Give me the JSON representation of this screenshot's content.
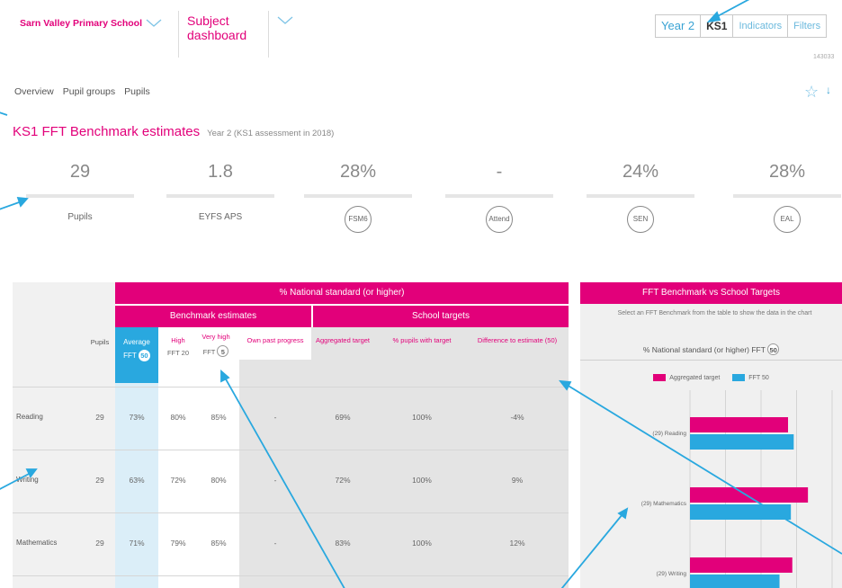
{
  "header": {
    "school_name": "Sarn Valley Primary School",
    "dashboard_title": "Subject dashboard",
    "tabs": [
      "Year 2",
      "KS1",
      "Indicators",
      "Filters"
    ],
    "small_code": "143033"
  },
  "nav": {
    "items": [
      "Overview",
      "Pupil groups",
      "Pupils"
    ]
  },
  "page": {
    "title": "KS1 FFT Benchmark estimates",
    "subtitle": "Year 2 (KS1 assessment in 2018)"
  },
  "stats": [
    {
      "value": "29",
      "label": "Pupils"
    },
    {
      "value": "1.8",
      "label": "EYFS APS"
    },
    {
      "value": "28%",
      "label": "FSM6"
    },
    {
      "value": "-",
      "label": "Attend"
    },
    {
      "value": "24%",
      "label": "SEN"
    },
    {
      "value": "28%",
      "label": "EAL"
    }
  ],
  "table": {
    "top_header": "% National standard (or higher)",
    "group_benchmark": "Benchmark estimates",
    "group_targets": "School targets",
    "columns": {
      "pupils": "Pupils",
      "average": "Average",
      "fft_avg": "FFT",
      "fft_avg_badge": "50",
      "high": "High",
      "fft_high": "FFT 20",
      "very_high": "Very high",
      "fft_vhigh": "FFT",
      "fft_vhigh_badge": "5",
      "own_past": "Own past progress",
      "aggregated": "Aggregated target",
      "pct_pupils": "% pupils with target",
      "difference": "Difference to estimate (50)"
    },
    "rows": [
      {
        "subject": "Reading",
        "pupils": "29",
        "average": "73%",
        "high": "80%",
        "very_high": "85%",
        "own": "-",
        "agg": "69%",
        "pct": "100%",
        "diff": "-4%"
      },
      {
        "subject": "Writing",
        "pupils": "29",
        "average": "63%",
        "high": "72%",
        "very_high": "80%",
        "own": "-",
        "agg": "72%",
        "pct": "100%",
        "diff": "9%"
      },
      {
        "subject": "Mathematics",
        "pupils": "29",
        "average": "71%",
        "high": "79%",
        "very_high": "85%",
        "own": "-",
        "agg": "83%",
        "pct": "100%",
        "diff": "12%"
      }
    ]
  },
  "panel": {
    "title": "FFT Benchmark vs School Targets",
    "note": "Select an FFT Benchmark from the table to show the data in the chart",
    "subtitle": "% National standard (or higher) FFT",
    "subtitle_badge": "50",
    "legend": [
      "Aggregated target",
      "FFT 50"
    ]
  },
  "chart_data": {
    "type": "bar",
    "orientation": "horizontal",
    "categories": [
      "(29) Reading",
      "(29) Mathematics",
      "(29) Writing"
    ],
    "series": [
      {
        "name": "Aggregated target",
        "values": [
          69,
          83,
          72
        ]
      },
      {
        "name": "FFT 50",
        "values": [
          73,
          71,
          63
        ]
      }
    ],
    "colors": [
      "#e2007a",
      "#29a8df"
    ],
    "xlim": [
      0,
      100
    ]
  },
  "colors": {
    "accent": "#e2007a",
    "blue": "#29a8df"
  }
}
